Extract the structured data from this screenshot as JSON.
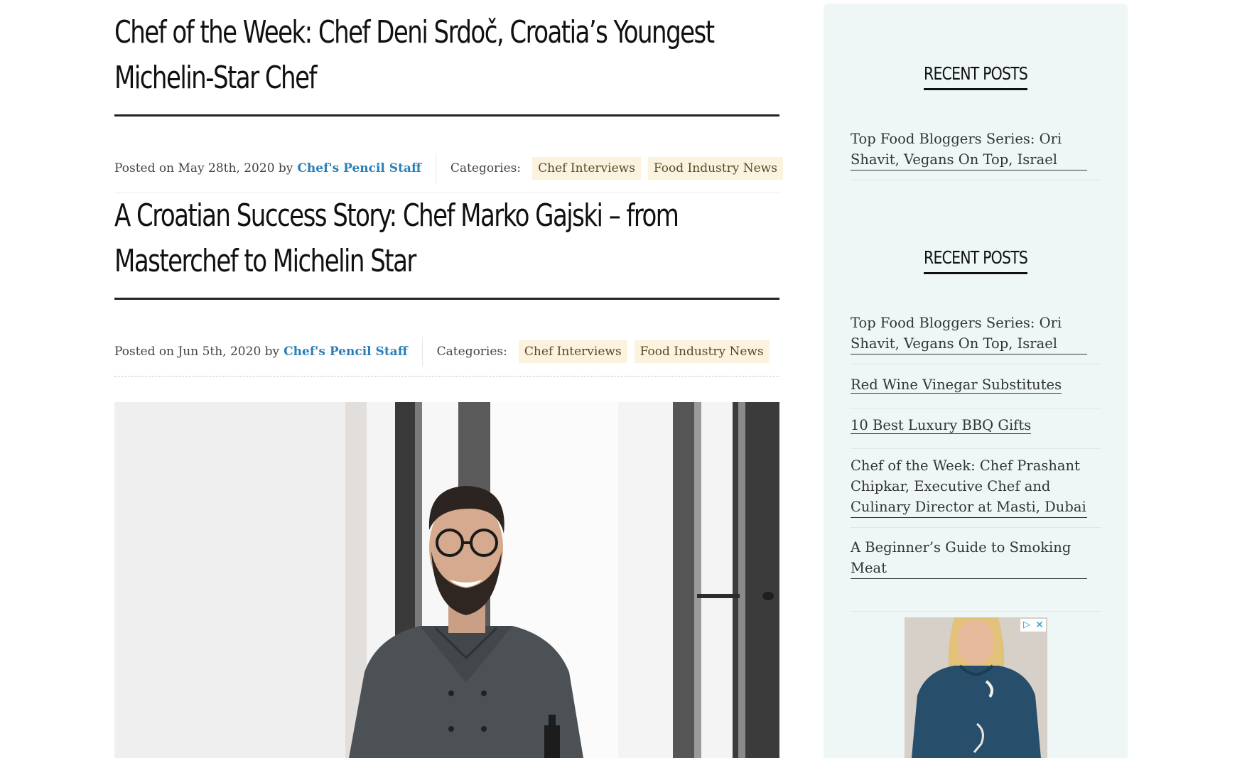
{
  "posts": [
    {
      "title_line1": "Chef of the Week: Chef Deni Srdoč, Croatia’s Youngest",
      "title_line2": "Michelin-Star Chef",
      "posted_on": "Posted on May 28th, 2020 by",
      "author": "Chef's Pencil Staff",
      "categories_label": "Categories:",
      "categories": [
        "Chef Interviews",
        "Food Industry News"
      ]
    },
    {
      "title_line1": "A Croatian Success Story: Chef Marko Gajski – from",
      "title_line2": "Masterchef to Michelin Star",
      "posted_on": "Posted on Jun 5th, 2020 by",
      "author": "Chef's Pencil Staff",
      "categories_label": "Categories:",
      "categories": [
        "Chef Interviews",
        "Food Industry News"
      ]
    }
  ],
  "sidebar": {
    "widget1": {
      "title": "RECENT POSTS",
      "items": [
        "Top Food Bloggers Series: Ori Shavit, Vegans On Top, Israel"
      ]
    },
    "widget2": {
      "title": "RECENT POSTS",
      "items": [
        "Top Food Bloggers Series: Ori Shavit, Vegans On Top, Israel",
        "Red Wine Vinegar Substitutes",
        "10 Best Luxury BBQ Gifts",
        "Chef of the Week: Chef Prashant Chipkar, Executive Chef and Culinary Director at Masti, Dubai",
        "A Beginner’s Guide to Smoking Meat"
      ]
    },
    "ad": {
      "choices_icon": "adchoices-icon",
      "close_icon": "close-icon"
    }
  },
  "colors": {
    "author_link": "#2a7fb8",
    "tag_bg": "#fbf3dd",
    "sidebar_bg": "#eef7f6"
  }
}
